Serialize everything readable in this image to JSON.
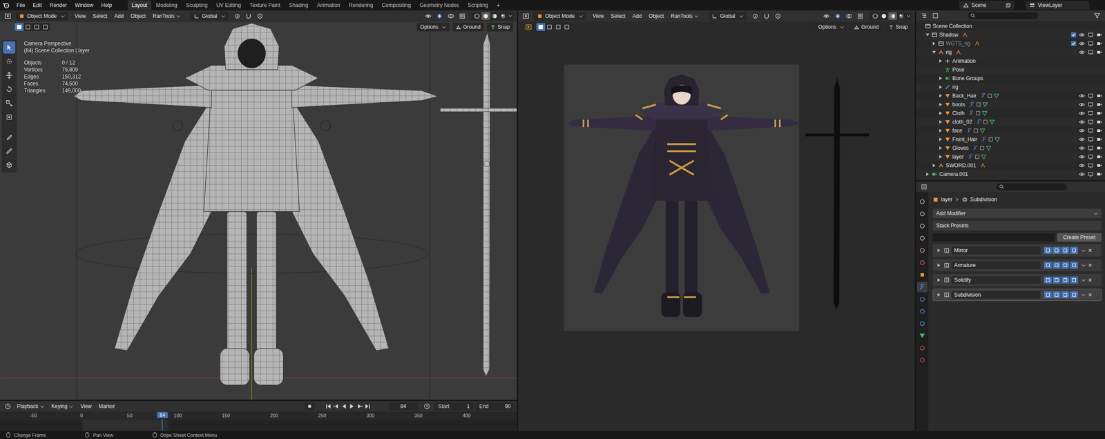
{
  "topbar": {
    "menus": [
      "File",
      "Edit",
      "Render",
      "Window",
      "Help"
    ],
    "workspaces": [
      {
        "label": "Layout",
        "selected": true
      },
      {
        "label": "Modeling",
        "selected": false
      },
      {
        "label": "Sculpting",
        "selected": false
      },
      {
        "label": "UV Editing",
        "selected": false
      },
      {
        "label": "Texture Paint",
        "selected": false
      },
      {
        "label": "Shading",
        "selected": false
      },
      {
        "label": "Animation",
        "selected": false
      },
      {
        "label": "Rendering",
        "selected": false
      },
      {
        "label": "Compositing",
        "selected": false
      },
      {
        "label": "Geometry Nodes",
        "selected": false
      },
      {
        "label": "Scripting",
        "selected": false
      }
    ],
    "add_workspace": "+",
    "scene": "Scene",
    "view_layer": "ViewLayer"
  },
  "viewports": [
    {
      "kind": "wireframe",
      "mode": "Object Mode",
      "menus": [
        {
          "label": "View",
          "dropdown": false
        },
        {
          "label": "Select",
          "dropdown": false
        },
        {
          "label": "Add",
          "dropdown": false
        },
        {
          "label": "Object",
          "dropdown": false
        },
        {
          "label": "RanTools",
          "dropdown": true
        }
      ],
      "orientation": "Global",
      "options": "Options",
      "ground": "Ground",
      "snap": "Snap",
      "shading": [
        {
          "mode": "wireframe",
          "selected": false
        },
        {
          "mode": "solid",
          "selected": true
        },
        {
          "mode": "material",
          "selected": false
        },
        {
          "mode": "rendered",
          "selected": false
        }
      ],
      "overlay": {
        "title": "Camera Perspective",
        "context": "(84) Scene Collection | layer",
        "stats": [
          {
            "label": "Objects",
            "value": "0 / 12"
          },
          {
            "label": "Vertices",
            "value": "75,809"
          },
          {
            "label": "Edges",
            "value": "150,312"
          },
          {
            "label": "Faces",
            "value": "74,500"
          },
          {
            "label": "Triangles",
            "value": "149,000"
          }
        ]
      }
    },
    {
      "kind": "render",
      "mode": "Object Mode",
      "menus": [
        {
          "label": "View",
          "dropdown": false
        },
        {
          "label": "Select",
          "dropdown": false
        },
        {
          "label": "Add",
          "dropdown": false
        },
        {
          "label": "Object",
          "dropdown": false
        },
        {
          "label": "RanTools",
          "dropdown": true
        }
      ],
      "orientation": "Global",
      "options": "Options",
      "ground": "Ground",
      "snap": "Snap",
      "shading": [
        {
          "mode": "wireframe",
          "selected": false
        },
        {
          "mode": "solid",
          "selected": false
        },
        {
          "mode": "material",
          "selected": true
        },
        {
          "mode": "rendered",
          "selected": false
        }
      ],
      "overlay": null
    }
  ],
  "timeline": {
    "menus": [
      {
        "label": "Playback",
        "dropdown": true
      },
      {
        "label": "Keying",
        "dropdown": true
      },
      {
        "label": "View",
        "dropdown": false
      },
      {
        "label": "Marker",
        "dropdown": false
      }
    ],
    "current_frame": "84",
    "start_label": "Start",
    "start": "1",
    "end_label": "End",
    "end": "90",
    "ruler": [
      "-50",
      "0",
      "50",
      "100",
      "150",
      "200",
      "250",
      "300",
      "350",
      "400"
    ],
    "playhead": "84"
  },
  "outliner": {
    "items": [
      {
        "label": "Scene Collection",
        "kind": "scene",
        "depth": 0,
        "children": false,
        "expanded": false,
        "dimmed": false,
        "toggles": false
      },
      {
        "label": "Shadow",
        "kind": "collection",
        "depth": 1,
        "children": true,
        "expanded": true,
        "dimmed": false,
        "toggles": true
      },
      {
        "label": "WGTS_rig",
        "kind": "collection",
        "depth": 2,
        "children": true,
        "expanded": false,
        "dimmed": true,
        "toggles": true
      },
      {
        "label": "rig",
        "kind": "armature",
        "depth": 2,
        "children": true,
        "expanded": true,
        "dimmed": false,
        "toggles": true
      },
      {
        "label": "Animation",
        "kind": "action",
        "depth": 3,
        "children": true,
        "expanded": false,
        "dimmed": false,
        "toggles": false
      },
      {
        "label": "Pose",
        "kind": "pose",
        "depth": 3,
        "children": false,
        "expanded": false,
        "dimmed": false,
        "toggles": false
      },
      {
        "label": "Bone Groups",
        "kind": "group",
        "depth": 3,
        "children": true,
        "expanded": false,
        "dimmed": false,
        "toggles": false
      },
      {
        "label": "rig",
        "kind": "armature-data",
        "depth": 3,
        "children": true,
        "expanded": false,
        "dimmed": false,
        "toggles": false
      },
      {
        "label": "Back_Hair",
        "kind": "mesh",
        "depth": 3,
        "children": true,
        "expanded": false,
        "dimmed": false,
        "toggles": true
      },
      {
        "label": "boots",
        "kind": "mesh",
        "depth": 3,
        "children": true,
        "expanded": false,
        "dimmed": false,
        "toggles": true
      },
      {
        "label": "Cloth",
        "kind": "mesh",
        "depth": 3,
        "children": true,
        "expanded": false,
        "dimmed": false,
        "toggles": true
      },
      {
        "label": "cloth_02",
        "kind": "mesh",
        "depth": 3,
        "children": true,
        "expanded": false,
        "dimmed": false,
        "toggles": true
      },
      {
        "label": "face",
        "kind": "mesh",
        "depth": 3,
        "children": true,
        "expanded": false,
        "dimmed": false,
        "toggles": true
      },
      {
        "label": "Front_Hair",
        "kind": "mesh",
        "depth": 3,
        "children": true,
        "expanded": false,
        "dimmed": false,
        "toggles": true
      },
      {
        "label": "Gloves",
        "kind": "mesh",
        "depth": 3,
        "children": true,
        "expanded": false,
        "dimmed": false,
        "toggles": true
      },
      {
        "label": "layer",
        "kind": "mesh",
        "depth": 3,
        "children": true,
        "expanded": false,
        "dimmed": false,
        "toggles": true
      },
      {
        "label": "SWORD.001",
        "kind": "armature",
        "depth": 2,
        "children": true,
        "expanded": false,
        "dimmed": false,
        "toggles": true
      },
      {
        "label": "Camera.001",
        "kind": "camera",
        "depth": 1,
        "children": true,
        "expanded": false,
        "dimmed": false,
        "toggles": true
      }
    ]
  },
  "properties": {
    "breadcrumb": [
      "layer",
      "Subdivision"
    ],
    "add_modifier": "Add Modifier",
    "stack_presets": "Stack Presets",
    "create_preset": "Create Preset",
    "modifiers": [
      {
        "name": "Mirror",
        "selected": false
      },
      {
        "name": "Armature",
        "selected": false
      },
      {
        "name": "Solidify",
        "selected": false
      },
      {
        "name": "Subdivision",
        "selected": true
      }
    ]
  },
  "status_bar": [
    {
      "label": "Change Frame"
    },
    {
      "label": "Pan View"
    },
    {
      "label": "Dope Sheet Context Menu"
    }
  ]
}
